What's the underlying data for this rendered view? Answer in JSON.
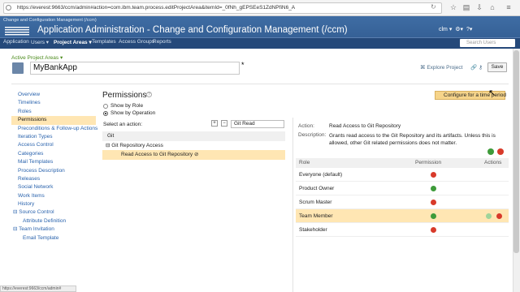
{
  "browser": {
    "url": "https://everest:9663/ccm/admin#action=com.ibm.team.process.editProjectArea&itemId=_0fNh_gEPSEeS1ZdNPfiN6_A"
  },
  "header": {
    "breadcrumb": "Change and Configuration Management (/ccm)",
    "title": "Application Administration - Change and Configuration Management (/ccm)",
    "user": "clm",
    "search_placeholder": "Search Users"
  },
  "nav": {
    "items": [
      "Application",
      "Users ▾",
      "Project Areas ▾",
      "Templates",
      "Access Groups",
      "Reports"
    ]
  },
  "area": {
    "active_label": "Active Project Areas ▾",
    "name": "MyBankApp",
    "explore": "Explore Project",
    "save": "Save"
  },
  "sidebar": {
    "items": [
      "Overview",
      "Timelines",
      "Roles",
      "Permissions",
      "Preconditions & Follow-up Actions",
      "Iteration Types",
      "Access Control",
      "Categories",
      "Mail Templates",
      "Process Description",
      "Releases",
      "Social Network",
      "Work Items",
      "History",
      "⊟ Source Control",
      "Attribute Definition",
      "⊟ Team Invitation",
      "Email Template"
    ]
  },
  "permissions": {
    "title": "Permissions",
    "help": "?",
    "show_by_role": "Show by Role",
    "show_by_operation": "Show by Operation",
    "select_action": "Select an action:",
    "filter_value": "Git Read",
    "configure": "Configure for a time period"
  },
  "tree": {
    "rows": [
      "Git",
      "⊟  Git Repository Access",
      "Read Access to Git Repository ⊘"
    ]
  },
  "detail": {
    "action_label": "Action:",
    "action_value": "Read Access to Git Repository",
    "desc_label": "Description:",
    "desc_value": "Grants read access to the Git Repository and its artifacts. Unless this is allowed, other Git related permissions does not matter."
  },
  "roles": {
    "headers": [
      "Role",
      "Permission",
      "Actions"
    ],
    "rows": [
      {
        "role": "Everyone (default)",
        "permission": "deny"
      },
      {
        "role": "Product Owner",
        "permission": "allow"
      },
      {
        "role": "Scrum Master",
        "permission": "deny"
      },
      {
        "role": "Team Member",
        "permission": "allow"
      },
      {
        "role": "Stakeholder",
        "permission": "deny"
      }
    ]
  },
  "status": {
    "text": "https://everest:9663/ccm/admin#"
  },
  "colors": {
    "header": "#3f6da4",
    "nav": "#25497a",
    "highlight": "#ffe6b3",
    "allow": "#3e9b3a",
    "deny": "#d83a2a"
  }
}
